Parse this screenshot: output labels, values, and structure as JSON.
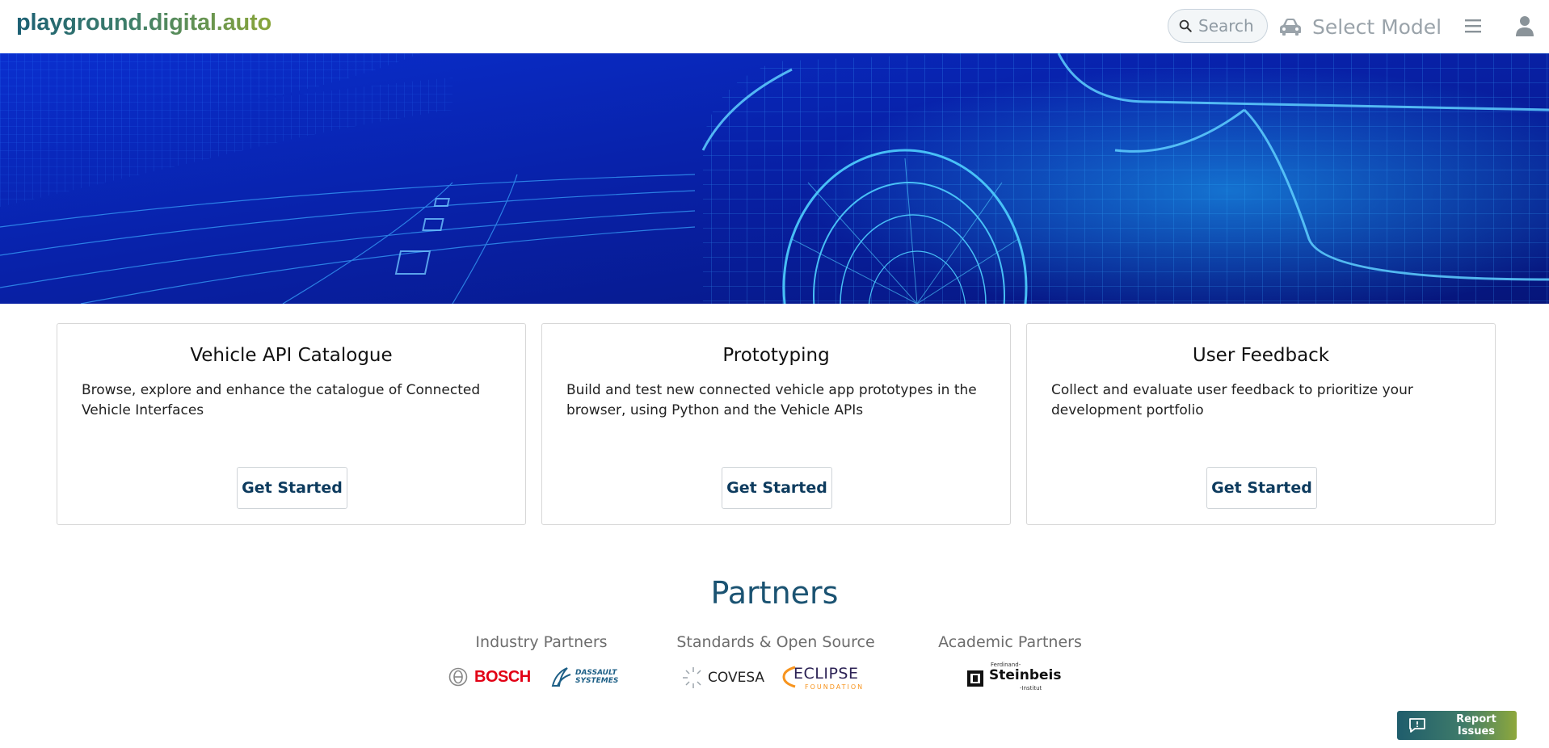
{
  "header": {
    "logo_text": "playground.digital.auto",
    "search_placeholder": "Search",
    "select_model_label": "Select Model"
  },
  "cards": [
    {
      "title": "Vehicle API Catalogue",
      "description": "Browse, explore and enhance the catalogue of Connected Vehicle Interfaces",
      "button_label": "Get Started"
    },
    {
      "title": "Prototyping",
      "description": "Build and test new connected vehicle app prototypes in the browser, using Python and the Vehicle APIs",
      "button_label": "Get Started"
    },
    {
      "title": "User Feedback",
      "description": "Collect and evaluate user feedback to prioritize your development portfolio",
      "button_label": "Get Started"
    }
  ],
  "partners": {
    "title": "Partners",
    "groups": [
      {
        "label": "Industry Partners",
        "logos": [
          "BOSCH",
          "DASSAULT SYSTEMES"
        ]
      },
      {
        "label": "Standards & Open Source",
        "logos": [
          "COVESA",
          "ECLIPSE",
          "FOUNDATION"
        ]
      },
      {
        "label": "Academic Partners",
        "logos": [
          "Ferdinand-",
          "Steinbeis",
          "-Institut"
        ]
      }
    ]
  },
  "report_issues_label": "Report Issues",
  "colors": {
    "brand_dark": "#1b5f73",
    "brand_green": "#8aa63a",
    "hero_blue": "#0a1f9e",
    "bosch_red": "#e20015",
    "eclipse_orange": "#f7941e"
  },
  "icons": {
    "search": "search-icon",
    "car": "car-icon",
    "menu": "menu-icon",
    "user": "user-icon",
    "report": "message-icon"
  }
}
